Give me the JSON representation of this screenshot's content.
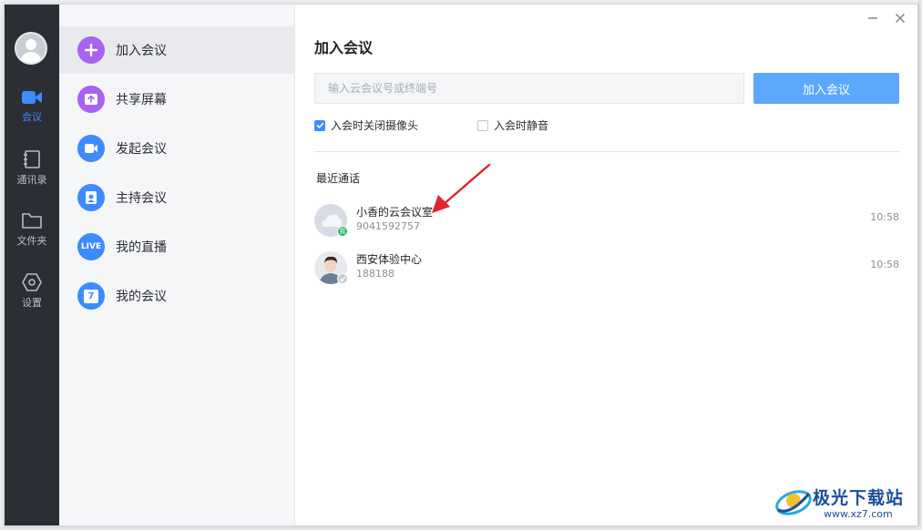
{
  "colors": {
    "rail_bg": "#2b2e35",
    "accent": "#3d8bff",
    "join_button": "#5ca8ff",
    "join_icon": "#a664f0",
    "share_icon": "#a664f0",
    "start_icon": "#3d8bff",
    "host_icon": "#3d8bff",
    "live_icon": "#3d8bff",
    "mine_icon": "#3d8bff",
    "annotation_arrow": "#e0262c"
  },
  "rail": {
    "avatar_icon": "user-avatar",
    "items": [
      {
        "label": "会议",
        "icon": "video-camera-icon",
        "active": true
      },
      {
        "label": "通讯录",
        "icon": "address-book-icon",
        "active": false
      },
      {
        "label": "文件夹",
        "icon": "folder-icon",
        "active": false
      },
      {
        "label": "设置",
        "icon": "gear-icon",
        "active": false
      }
    ]
  },
  "menu": {
    "items": [
      {
        "label": "加入会议",
        "icon": "plus-icon",
        "active": true
      },
      {
        "label": "共享屏幕",
        "icon": "share-screen-icon",
        "active": false
      },
      {
        "label": "发起会议",
        "icon": "video-camera-icon",
        "active": false
      },
      {
        "label": "主持会议",
        "icon": "host-icon",
        "active": false
      },
      {
        "label": "我的直播",
        "icon": "live-icon",
        "active": false,
        "icon_text": "LIVE"
      },
      {
        "label": "我的会议",
        "icon": "calendar-icon",
        "active": false,
        "icon_text": "7"
      }
    ]
  },
  "main": {
    "title": "加入会议",
    "input": {
      "placeholder": "输入云会议号或终端号",
      "value": ""
    },
    "join_button": "加入会议",
    "options": [
      {
        "label": "入会时关闭摄像头",
        "checked": true
      },
      {
        "label": "入会时静音",
        "checked": false
      }
    ],
    "recent_title": "最近通话",
    "recent_calls": [
      {
        "name": "小香的云会议室",
        "number": "9041592757",
        "time": "10:58",
        "badge": "我",
        "avatar": "cloud-avatar"
      },
      {
        "name": "西安体验中心",
        "number": "188188",
        "time": "10:58",
        "badge": "",
        "avatar": "person-avatar"
      }
    ]
  },
  "watermark": {
    "title": "极光下载站",
    "url": "www.xz7.com"
  }
}
